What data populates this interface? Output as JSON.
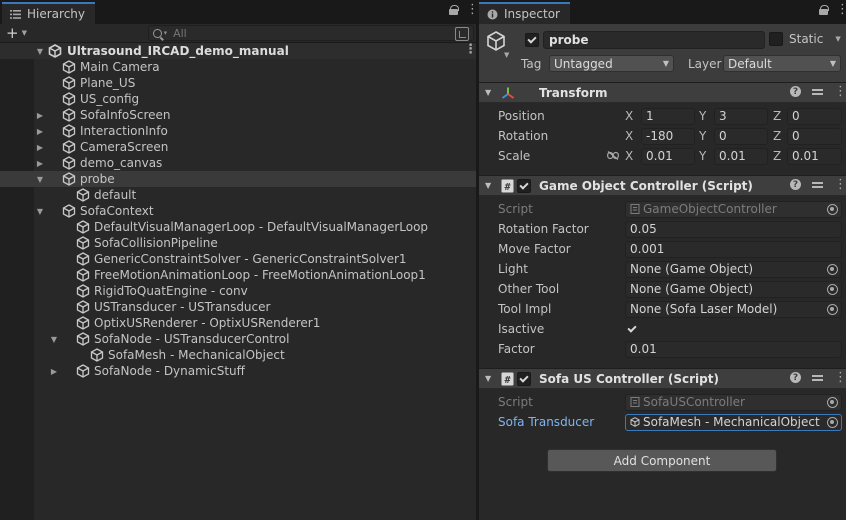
{
  "hierarchy": {
    "tab_label": "Hierarchy",
    "add_label": "+",
    "search_placeholder": "All",
    "scene": "Ultrasound_IRCAD_demo_manual",
    "items": [
      {
        "label": "Main Camera",
        "depth": 1,
        "expandable": false
      },
      {
        "label": "Plane_US",
        "depth": 1,
        "expandable": false
      },
      {
        "label": "US_config",
        "depth": 1,
        "expandable": false
      },
      {
        "label": "SofaInfoScreen",
        "depth": 1,
        "expandable": true,
        "expanded": false
      },
      {
        "label": "InteractionInfo",
        "depth": 1,
        "expandable": true,
        "expanded": false
      },
      {
        "label": "CameraScreen",
        "depth": 1,
        "expandable": true,
        "expanded": false
      },
      {
        "label": "demo_canvas",
        "depth": 1,
        "expandable": true,
        "expanded": false
      },
      {
        "label": "probe",
        "depth": 1,
        "expandable": true,
        "expanded": true,
        "selected": true
      },
      {
        "label": "default",
        "depth": 2,
        "expandable": false
      },
      {
        "label": "SofaContext",
        "depth": 1,
        "expandable": true,
        "expanded": true
      },
      {
        "label": "DefaultVisualManagerLoop  -  DefaultVisualManagerLoop",
        "depth": 2,
        "expandable": false
      },
      {
        "label": "SofaCollisionPipeline",
        "depth": 2,
        "expandable": false
      },
      {
        "label": "GenericConstraintSolver  -  GenericConstraintSolver1",
        "depth": 2,
        "expandable": false
      },
      {
        "label": "FreeMotionAnimationLoop  -  FreeMotionAnimationLoop1",
        "depth": 2,
        "expandable": false
      },
      {
        "label": "RigidToQuatEngine  -  conv",
        "depth": 2,
        "expandable": false
      },
      {
        "label": "USTransducer  -  USTransducer",
        "depth": 2,
        "expandable": false
      },
      {
        "label": "OptixUSRenderer  -  OptixUSRenderer1",
        "depth": 2,
        "expandable": false
      },
      {
        "label": "SofaNode - USTransducerControl",
        "depth": 2,
        "expandable": true,
        "expanded": true
      },
      {
        "label": "SofaMesh  -  MechanicalObject",
        "depth": 3,
        "expandable": false
      },
      {
        "label": "SofaNode - DynamicStuff",
        "depth": 2,
        "expandable": true,
        "expanded": false
      }
    ]
  },
  "inspector": {
    "tab_label": "Inspector",
    "object_name": "probe",
    "active": true,
    "static_label": "Static",
    "tag_label": "Tag",
    "tag_value": "Untagged",
    "layer_label": "Layer",
    "layer_value": "Default",
    "transform": {
      "title": "Transform",
      "rows": [
        {
          "label": "Position",
          "x": "1",
          "y": "3",
          "z": "0"
        },
        {
          "label": "Rotation",
          "x": "-180",
          "y": "0",
          "z": "0"
        },
        {
          "label": "Scale",
          "x": "0.01",
          "y": "0.01",
          "z": "0.01"
        }
      ],
      "axis_x": "X",
      "axis_y": "Y",
      "axis_z": "Z"
    },
    "game_object_controller": {
      "title": "Game Object Controller (Script)",
      "enabled": true,
      "props": [
        {
          "label": "Script",
          "value": "GameObjectController",
          "kind": "script"
        },
        {
          "label": "Rotation Factor",
          "value": "0.05",
          "kind": "text"
        },
        {
          "label": "Move Factor",
          "value": "0.001",
          "kind": "text"
        },
        {
          "label": "Light",
          "value": "None (Game Object)",
          "kind": "object"
        },
        {
          "label": "Other Tool",
          "value": "None (Game Object)",
          "kind": "object"
        },
        {
          "label": "Tool Impl",
          "value": "None (Sofa Laser Model)",
          "kind": "object"
        },
        {
          "label": "Isactive",
          "value": "",
          "kind": "checkbox",
          "checked": true
        },
        {
          "label": "Factor",
          "value": "0.01",
          "kind": "text"
        }
      ]
    },
    "sofa_us_controller": {
      "title": "Sofa US Controller (Script)",
      "enabled": true,
      "props": [
        {
          "label": "Script",
          "value": "SofaUSController",
          "kind": "script"
        },
        {
          "label": "Sofa Transducer",
          "value": "SofaMesh  -  MechanicalObject",
          "kind": "object-highlight"
        }
      ]
    },
    "add_component_label": "Add Component"
  },
  "colors": {
    "accent": "#3a79bb",
    "panel": "#282828",
    "header": "#3c3c3c",
    "link": "#7fb4f0"
  }
}
